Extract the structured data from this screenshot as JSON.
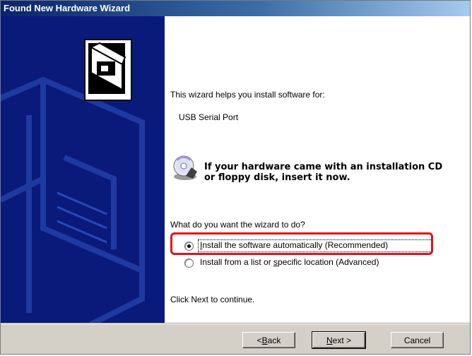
{
  "window": {
    "title": "Found New Hardware Wizard"
  },
  "content": {
    "intro": "This wizard helps you install software for:",
    "device_name": "USB Serial Port",
    "cd_notice_line1": "If your hardware came with an installation CD",
    "cd_notice_line2": "or floppy disk, insert it now.",
    "question": "What do you want the wizard to do?",
    "options": [
      {
        "label_pre": "",
        "label_u": "I",
        "label_post": "nstall the software automatically (Recommended)",
        "selected": true
      },
      {
        "label_pre": "Install from a list or ",
        "label_u": "s",
        "label_post": "pecific location (Advanced)",
        "selected": false
      }
    ],
    "continue_hint": "Click Next to continue."
  },
  "footer": {
    "back": {
      "pre": "< ",
      "u": "B",
      "post": "ack"
    },
    "next": {
      "pre": "",
      "u": "N",
      "post": "ext >"
    },
    "cancel": "Cancel"
  },
  "colors": {
    "title_gradient_start": "#0a246a",
    "side_panel": "#0a1a7a",
    "highlight": "#e3121a",
    "face": "#d4d0c8"
  }
}
